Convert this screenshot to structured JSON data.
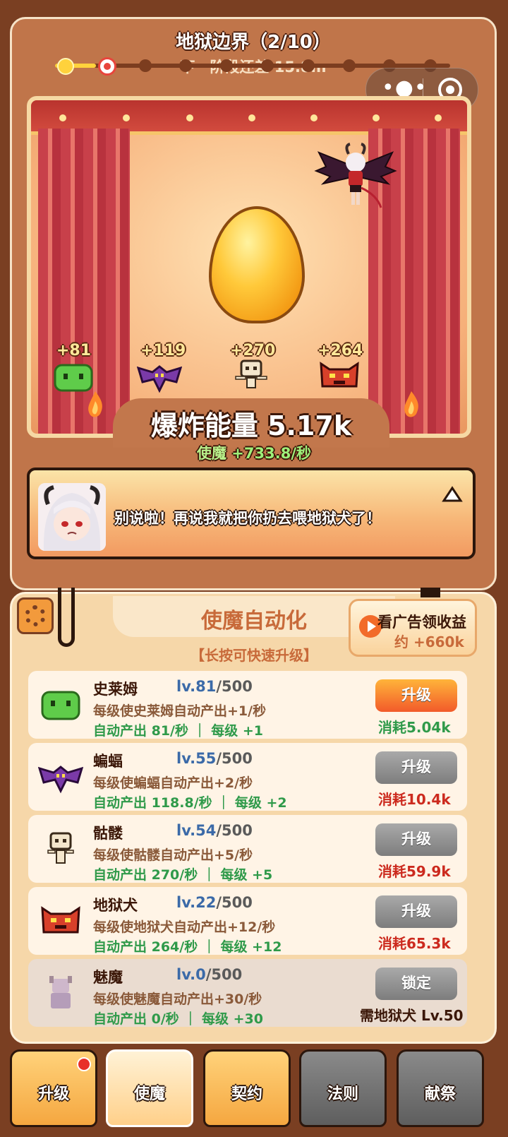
{
  "stage": {
    "title": "地狱边界（2/10）",
    "next_stage_text": "下一阶段还差 15.8m",
    "progress": {
      "current": 2,
      "total": 10
    }
  },
  "capsule": {
    "more_icon": "more-dots-icon",
    "close_icon": "target-icon"
  },
  "minions_gain": [
    {
      "name": "slime",
      "gain": "+81"
    },
    {
      "name": "bat",
      "gain": "+119"
    },
    {
      "name": "skeleton",
      "gain": "+270"
    },
    {
      "name": "hellhound",
      "gain": "+264"
    }
  ],
  "energy": {
    "label": "爆炸能量 5.17k",
    "rate_label": "使魔",
    "rate_value": "+733.8/秒"
  },
  "dialog": {
    "text": "别说啦！再说我就把你扔去喂地狱犬了！"
  },
  "panel": {
    "title": "使魔自动化",
    "hint": "【长按可快速升级】",
    "ad_line1": "看广告领收益",
    "ad_line2": "约 +660k"
  },
  "rows": [
    {
      "name": "史莱姆",
      "level": "lv.81",
      "max": "/500",
      "desc": "每级使史莱姆自动产出+1/秒",
      "output": "自动产出 81/秒 ｜ 每级 +1",
      "button": "升级",
      "cost": "消耗5.04k",
      "affordable": true
    },
    {
      "name": "蝙蝠",
      "level": "lv.55",
      "max": "/500",
      "desc": "每级使蝙蝠自动产出+2/秒",
      "output": "自动产出 118.8/秒 ｜ 每级 +2",
      "button": "升级",
      "cost": "消耗10.4k",
      "affordable": false
    },
    {
      "name": "骷髅",
      "level": "lv.54",
      "max": "/500",
      "desc": "每级使骷髅自动产出+5/秒",
      "output": "自动产出 270/秒 ｜ 每级 +5",
      "button": "升级",
      "cost": "消耗59.9k",
      "affordable": false
    },
    {
      "name": "地狱犬",
      "level": "lv.22",
      "max": "/500",
      "desc": "每级使地狱犬自动产出+12/秒",
      "output": "自动产出 264/秒 ｜ 每级 +12",
      "button": "升级",
      "cost": "消耗65.3k",
      "affordable": false
    },
    {
      "name": "魅魔",
      "level": "lv.0",
      "max": "/500",
      "desc": "每级使魅魔自动产出+30/秒",
      "output": "自动产出 0/秒 ｜ 每级 +30",
      "button": "锁定",
      "requirement": "需地狱犬 Lv.50",
      "locked": true
    }
  ],
  "tabs": [
    {
      "label": "升级",
      "badge": true
    },
    {
      "label": "使魔",
      "selected": true
    },
    {
      "label": "契约"
    },
    {
      "label": "法则",
      "disabled": true
    },
    {
      "label": "献祭",
      "disabled": true
    }
  ],
  "colors": {
    "accent": "#f25a2a",
    "green": "#2f9a4a",
    "cost_red": "#cc2a1e",
    "background": "#7a3f22"
  }
}
